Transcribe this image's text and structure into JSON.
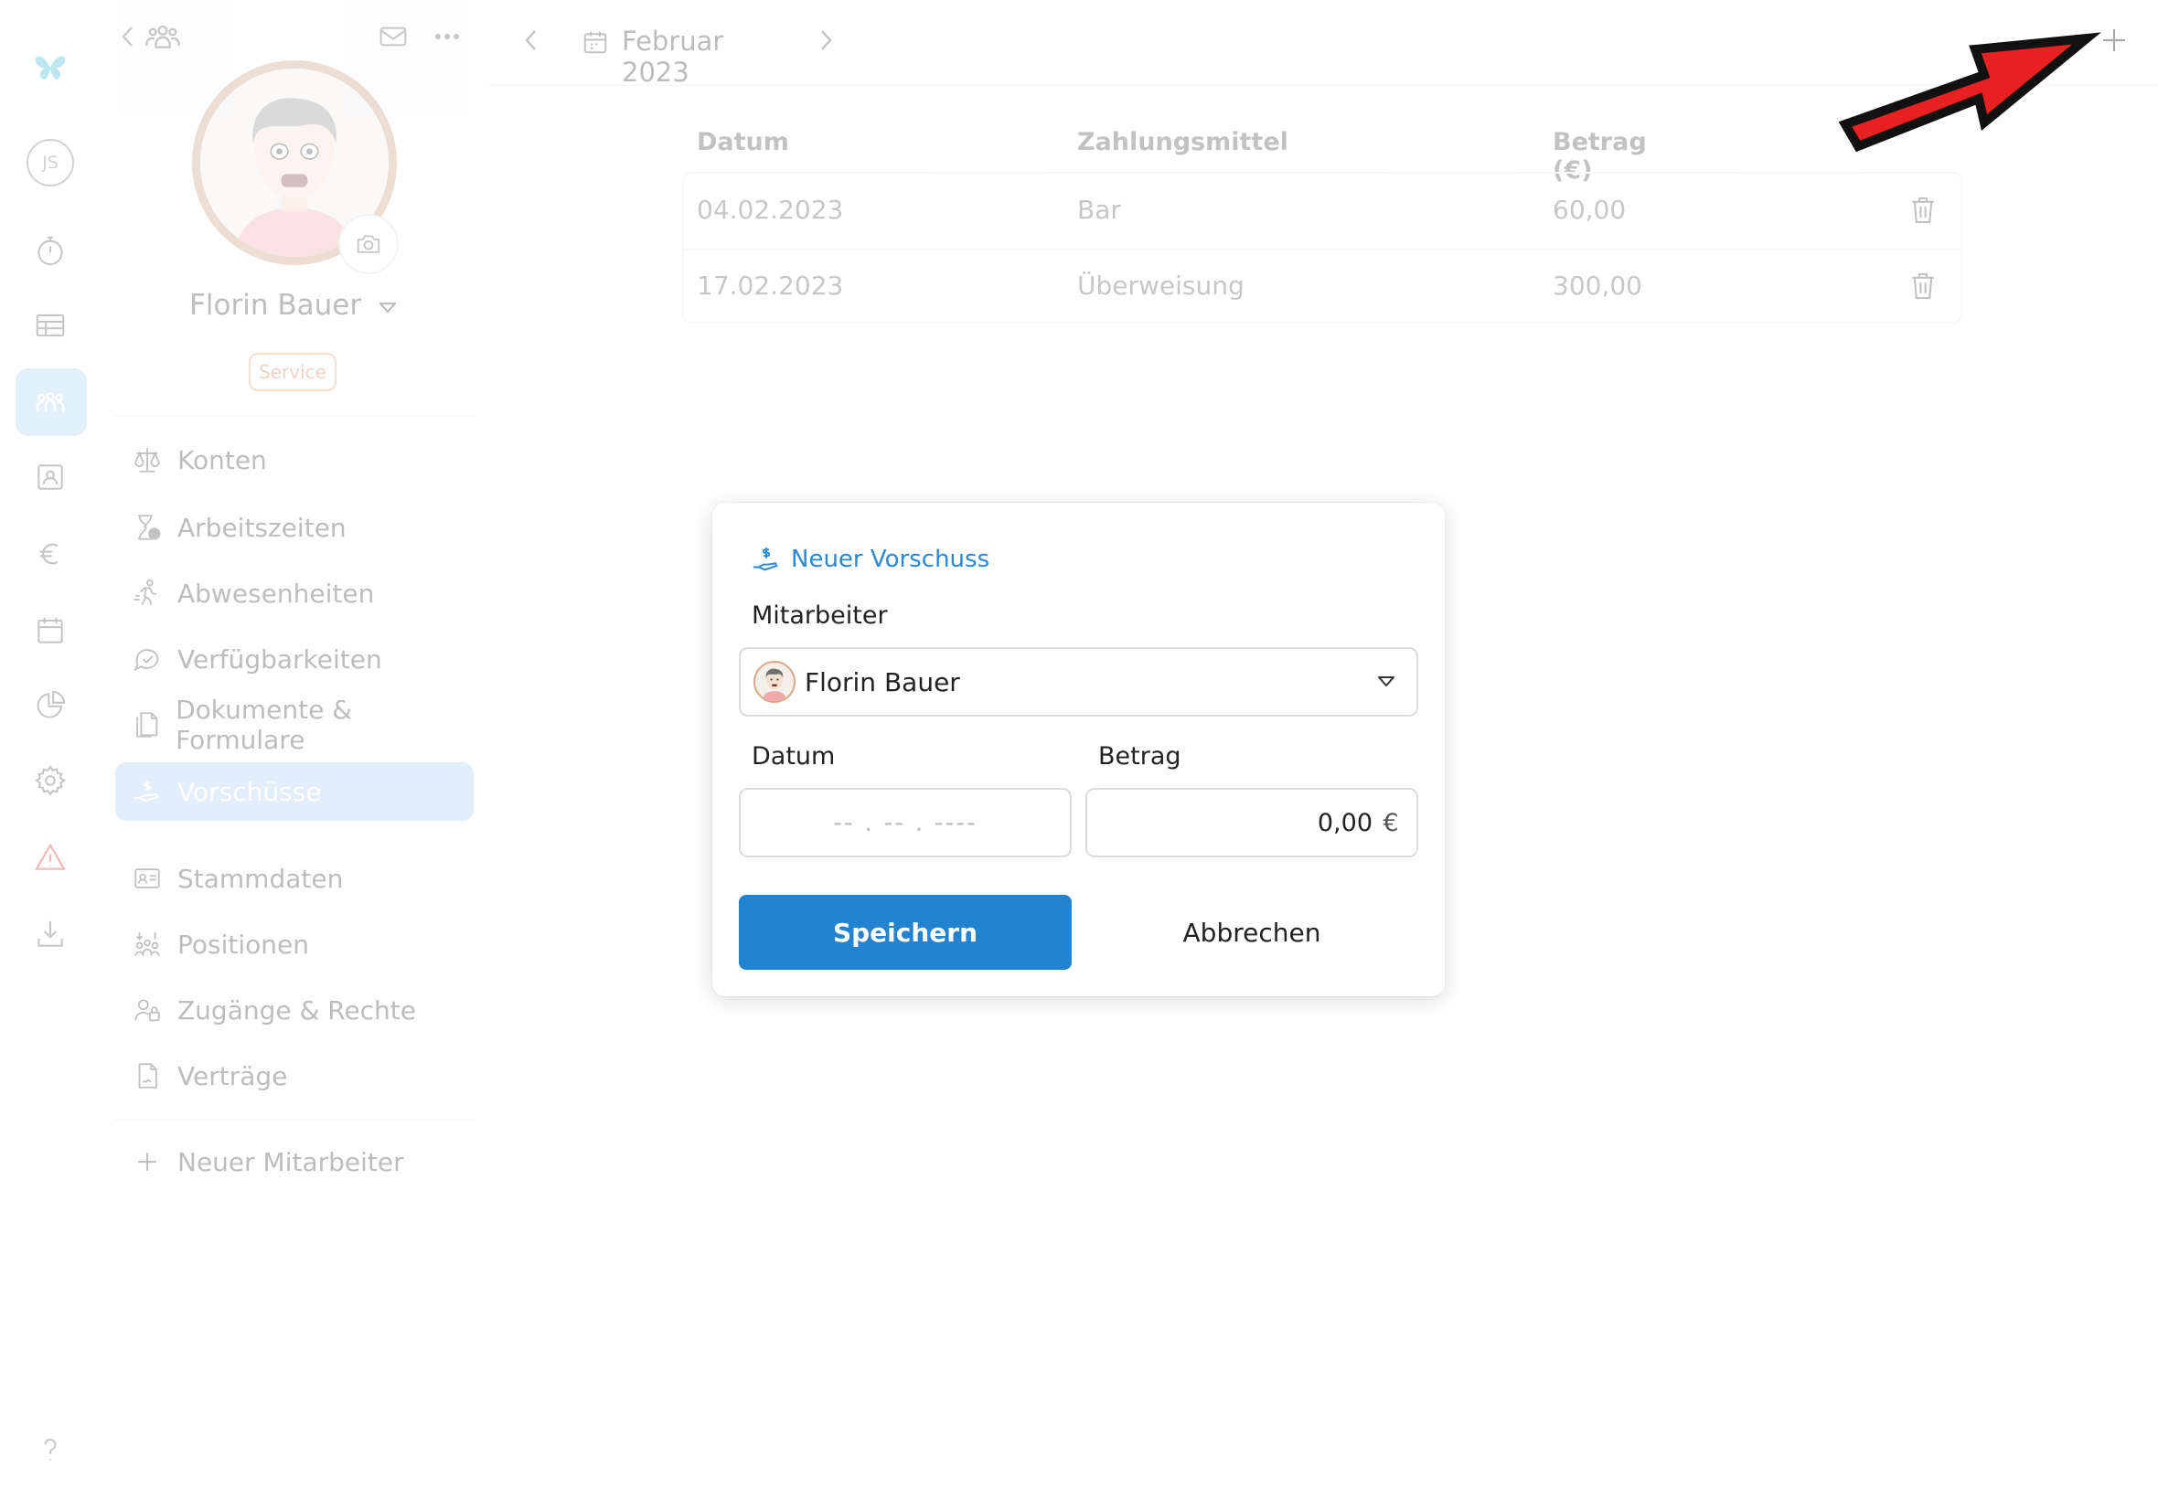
{
  "rail": {
    "account_initials": "JS",
    "icons": [
      "butterfly-logo-icon",
      "stopwatch-icon",
      "table-icon",
      "team-icon",
      "contact-card-icon",
      "euro-icon",
      "calendar-icon",
      "pie-chart-icon",
      "gear-icon",
      "warning-icon",
      "download-icon",
      "help-icon"
    ],
    "active": "team-icon"
  },
  "panel": {
    "employee_name": "Florin Bauer",
    "role_badge": "Service",
    "nav": [
      {
        "label": "Konten",
        "icon": "scale-icon"
      },
      {
        "label": "Arbeitszeiten",
        "icon": "hourglass-icon"
      },
      {
        "label": "Abwesenheiten",
        "icon": "running-person-icon"
      },
      {
        "label": "Verfügbarkeiten",
        "icon": "chat-check-icon"
      },
      {
        "label": "Dokumente & Formulare",
        "icon": "documents-icon"
      },
      {
        "label": "Vorschüsse",
        "icon": "hand-money-icon",
        "active": true
      },
      {
        "label": "Stammdaten",
        "icon": "id-card-icon"
      },
      {
        "label": "Positionen",
        "icon": "positions-icon"
      },
      {
        "label": "Zugänge & Rechte",
        "icon": "user-lock-icon"
      },
      {
        "label": "Verträge",
        "icon": "contract-icon"
      }
    ],
    "new_employee": "Neuer Mitarbeiter"
  },
  "topbar": {
    "month": "Februar 2023"
  },
  "table": {
    "columns": [
      "Datum",
      "Zahlungsmittel",
      "Betrag (€)"
    ],
    "rows": [
      {
        "date": "04.02.2023",
        "method": "Bar",
        "amount": "60,00"
      },
      {
        "date": "17.02.2023",
        "method": "Überweisung",
        "amount": "300,00"
      }
    ]
  },
  "dialog": {
    "title": "Neuer Vorschuss",
    "employee_label": "Mitarbeiter",
    "employee_value": "Florin Bauer",
    "date_label": "Datum",
    "date_placeholder": "-- . -- . ----",
    "amount_label": "Betrag",
    "amount_value": "0,00",
    "currency": "€",
    "save": "Speichern",
    "cancel": "Abbrechen"
  },
  "colors": {
    "accent": "#2483d1",
    "active_bg": "#a7d1f2",
    "badge": "#e59b6f",
    "annotation_arrow": "#e8201f"
  }
}
